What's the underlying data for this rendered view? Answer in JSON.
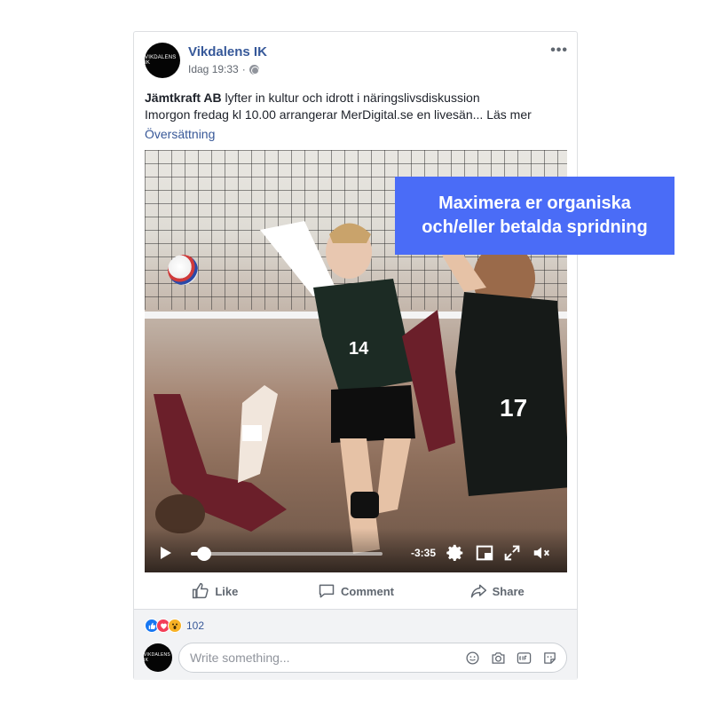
{
  "post": {
    "avatar_text": "VIKDALENS IK",
    "page_name": "Vikdalens IK",
    "timestamp": "Idag 19:33",
    "separator": "·",
    "privacy_icon": "globe-icon",
    "more_icon": "more-options-icon",
    "more_label": "•••",
    "text_bold": "Jämtkraft AB",
    "text_line1": " lyfter in kultur och idrott i näringslivsdiskussion",
    "text_line2": "Imorgon fredag kl 10.00 arrangerar MerDigital.se en livesän... Läs mer",
    "translation_link": "Översättning"
  },
  "video": {
    "progress": 0.07,
    "time_remaining": "-3:35",
    "jersey_left": "14",
    "jersey_right": "17",
    "controls": [
      "play-icon",
      "settings-icon",
      "picture-in-picture-icon",
      "fullscreen-icon",
      "mute-icon"
    ]
  },
  "overlay": {
    "line1": "Maximera er organiska",
    "line2": "och/eller betalda spridning",
    "color": "#4a6cf7"
  },
  "actions": {
    "like": "Like",
    "comment": "Comment",
    "share": "Share"
  },
  "reactions": {
    "count": "102",
    "types": [
      "like",
      "love",
      "wow"
    ]
  },
  "comment": {
    "avatar_text": "VIKDALENS IK",
    "placeholder": "Write something...",
    "icons": [
      "emoji-icon",
      "camera-icon",
      "gif-icon",
      "sticker-icon"
    ]
  }
}
